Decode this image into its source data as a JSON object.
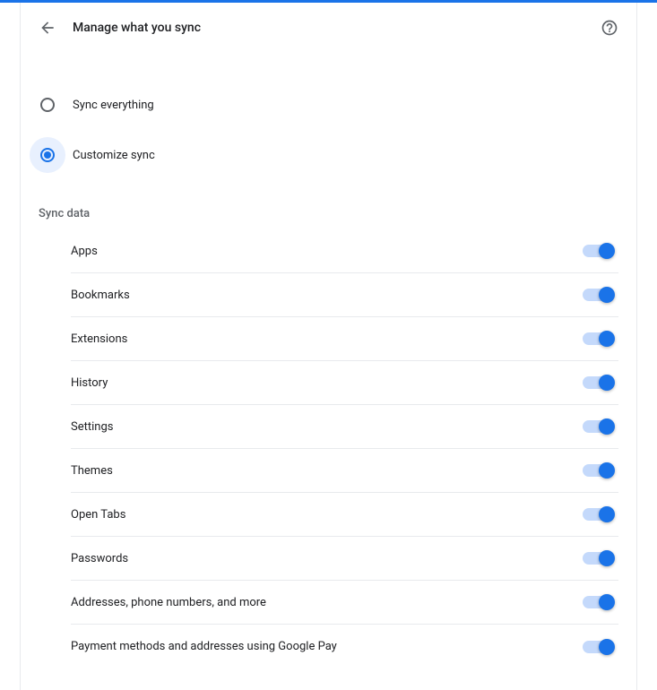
{
  "header": {
    "title": "Manage what you sync"
  },
  "syncOptions": [
    {
      "label": "Sync everything",
      "selected": false
    },
    {
      "label": "Customize sync",
      "selected": true
    }
  ],
  "sectionHeading": "Sync data",
  "toggleItems": [
    {
      "label": "Apps",
      "on": true
    },
    {
      "label": "Bookmarks",
      "on": true
    },
    {
      "label": "Extensions",
      "on": true
    },
    {
      "label": "History",
      "on": true
    },
    {
      "label": "Settings",
      "on": true
    },
    {
      "label": "Themes",
      "on": true
    },
    {
      "label": "Open Tabs",
      "on": true
    },
    {
      "label": "Passwords",
      "on": true
    },
    {
      "label": "Addresses, phone numbers, and more",
      "on": true
    },
    {
      "label": "Payment methods and addresses using Google Pay",
      "on": true
    }
  ]
}
